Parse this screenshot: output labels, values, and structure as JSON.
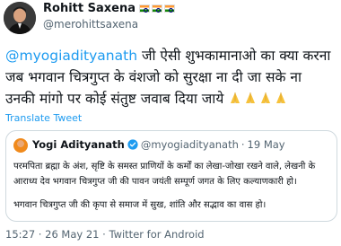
{
  "author": {
    "name": "Rohitt Saxena",
    "handle": "@merohittsaxena"
  },
  "tweet": {
    "mention": "@myogiadityanath",
    "line1_rest": " जी ऐसी शुभकामानाओ का क्या करना",
    "line2": "जब भगवान  चित्रगुप्त के वंशजो को सुरक्षा ना दी जा सके ना",
    "line3": "उनकी मांगो पर कोई संतुष्ट जवाब दिया जाये "
  },
  "translate_label": "Translate Tweet",
  "quoted": {
    "name": "Yogi Adityanath",
    "handle": "@myogiadityanath",
    "separator": "·",
    "date": "19 May",
    "para1": "परमपिता ब्रह्मा के अंश, सृष्टि के समस्त प्राणियों के कर्मों का लेखा-जोखा रखने वाले, लेखनी के आराध्य देव भगवान चित्रगुप्त जी की पावन जयंती सम्पूर्ण जगत के लिए कल्याणकारी हो।",
    "para2": "भगवान चित्रगुप्त जी की कृपा से समाज में सुख, शांति और सद्भाव का वास हो।"
  },
  "meta": {
    "time": "15:27",
    "separator1": " · ",
    "date": "26 May 21",
    "separator2": " · ",
    "source": "Twitter for Android"
  },
  "icons": {
    "flag": "india-flag-icon",
    "hands": "folded-hands-icon",
    "verified": "verified-badge-icon"
  },
  "colors": {
    "link": "#1d9bf0",
    "secondary_text": "#536471",
    "border": "#cfd9de",
    "text": "#0f1419"
  }
}
